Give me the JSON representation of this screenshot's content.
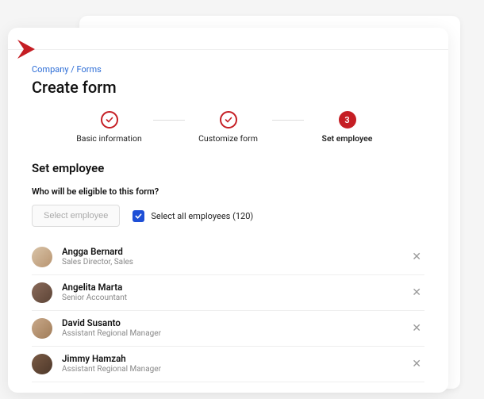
{
  "brand_color": "#c51e24",
  "breadcrumb": {
    "company": "Company",
    "sep": " / ",
    "forms": "Forms"
  },
  "page_title": "Create form",
  "stepper": [
    {
      "label": "Basic information",
      "state": "done"
    },
    {
      "label": "Customize form",
      "state": "done"
    },
    {
      "label": "Set employee",
      "state": "active",
      "number": "3"
    }
  ],
  "section_title": "Set employee",
  "question": "Who will be eligible to this form?",
  "select_button": "Select employee",
  "select_all": {
    "checked": true,
    "label": "Select all employees (120)"
  },
  "employees": [
    {
      "name": "Angga Bernard",
      "role": "Sales Director, Sales",
      "avatar_bg": "linear-gradient(135deg,#d9c4a8,#b89470)"
    },
    {
      "name": "Angelita Marta",
      "role": "Senior Accountant",
      "avatar_bg": "linear-gradient(135deg,#8a6a5a,#5c4436)"
    },
    {
      "name": "David Susanto",
      "role": "Assistant Regional Manager",
      "avatar_bg": "linear-gradient(135deg,#c9a98a,#a07c58)"
    },
    {
      "name": "Jimmy Hamzah",
      "role": "Assistant Regional Manager",
      "avatar_bg": "linear-gradient(135deg,#7a5a44,#4d382a)"
    }
  ]
}
